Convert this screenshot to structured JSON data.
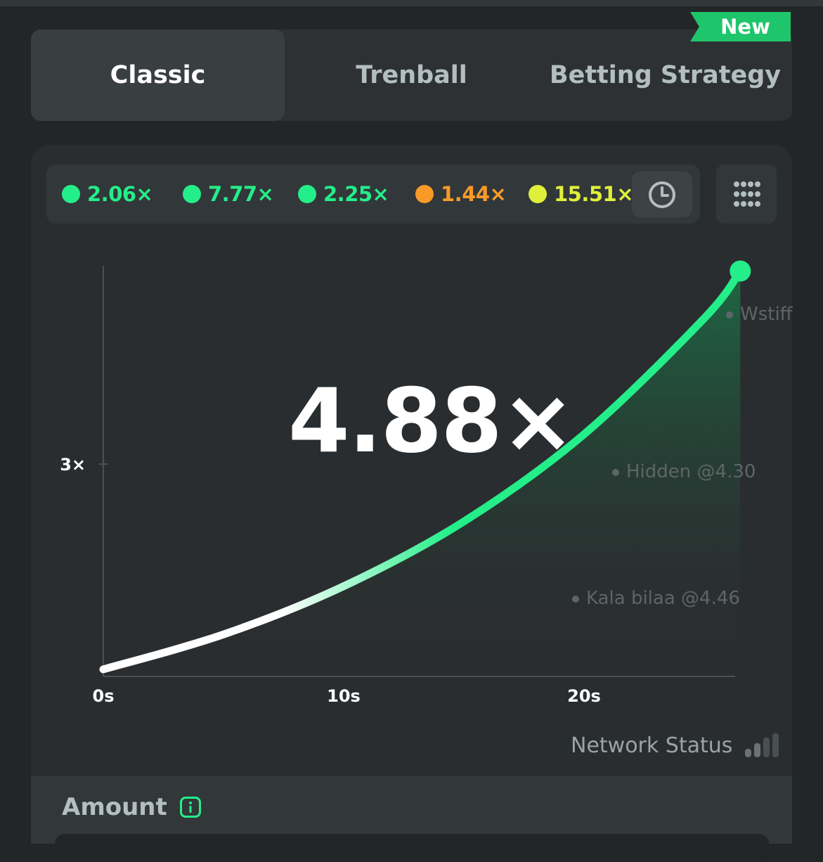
{
  "tabs": [
    {
      "label": "Classic",
      "active": true
    },
    {
      "label": "Trenball",
      "active": false
    },
    {
      "label": "Betting Strategy",
      "active": false
    }
  ],
  "new_badge": "New",
  "history": [
    {
      "value": "2.06×",
      "color": "#24ee89"
    },
    {
      "value": "7.77×",
      "color": "#24ee89"
    },
    {
      "value": "2.25×",
      "color": "#24ee89"
    },
    {
      "value": "1.44×",
      "color": "#f79a26"
    },
    {
      "value": "15.51×",
      "color": "#dff03c"
    }
  ],
  "icons": {
    "history": "clock-icon",
    "more": "grid-dots-icon",
    "info": "info-icon"
  },
  "current_multiplier": "4.88×",
  "chart_data": {
    "type": "line",
    "x_ticks": [
      "0s",
      "10s",
      "20s"
    ],
    "y_ticks": [
      "3×"
    ],
    "x": [
      0,
      5,
      10,
      15,
      20,
      25,
      26.5
    ],
    "y": [
      1.0,
      1.34,
      1.81,
      2.44,
      3.29,
      4.42,
      4.88
    ],
    "line_color": "#24ee89"
  },
  "players": [
    {
      "name": "Wstiff"
    },
    {
      "name": "Hidden @4.30"
    },
    {
      "name": "Kala bilaa @4.46"
    }
  ],
  "network_status": "Network Status",
  "amount": {
    "label": "Amount"
  }
}
